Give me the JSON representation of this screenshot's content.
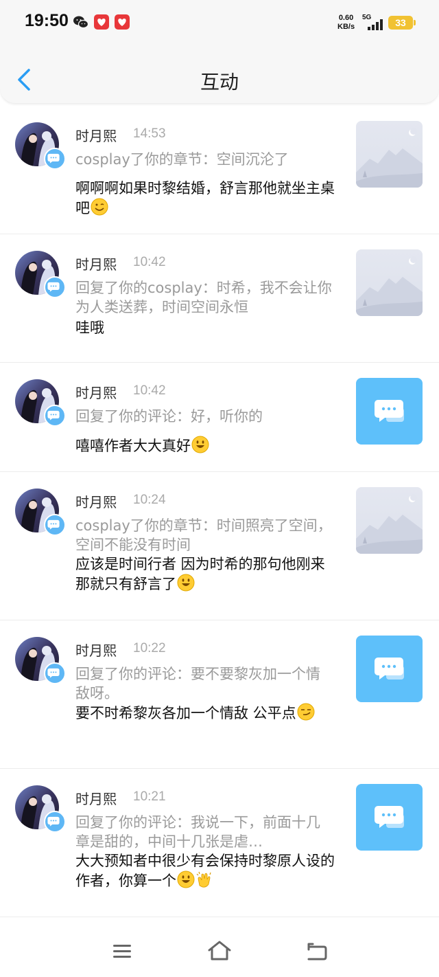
{
  "status_bar": {
    "time": "19:50",
    "net_speed_value": "0.60",
    "net_speed_unit": "KB/s",
    "net_type": "5G",
    "battery": "33",
    "icons": [
      "wechat-icon",
      "app-heart-icon",
      "app-heart-icon"
    ]
  },
  "header": {
    "title": "互动",
    "back_icon": "chevron-left-icon"
  },
  "colors": {
    "accent": "#5eb7f5",
    "message_thumb": "#5ec0fa",
    "battery": "#f1c232"
  },
  "items": [
    {
      "user": "时月熙",
      "time": "14:53",
      "quote": "cosplay了你的章节：空间沉沦了",
      "reply": "啊啊啊如果时黎结婚，舒言那他就坐主桌吧",
      "emoji": [
        "winking-face-icon"
      ],
      "thumb": "image-placeholder-icon"
    },
    {
      "user": "时月熙",
      "time": "10:42",
      "quote": "回复了你的cosplay：时希，我不会让你为人类送葬，时间空间永恒",
      "reply": "哇哦",
      "emoji": [],
      "thumb": "image-placeholder-icon"
    },
    {
      "user": "时月熙",
      "time": "10:42",
      "quote": "回复了你的评论：好，听你的",
      "reply": "嘻嘻作者大大真好",
      "emoji": [
        "smiling-face-icon"
      ],
      "thumb": "comment-bubble-icon"
    },
    {
      "user": "时月熙",
      "time": "10:24",
      "quote": "cosplay了你的章节：时间照亮了空间，空间不能没有时间",
      "reply": "应该是时间行者 因为时希的那句他刚来 那就只有舒言了",
      "emoji": [
        "smiling-face-icon"
      ],
      "thumb": "image-placeholder-icon"
    },
    {
      "user": "时月熙",
      "time": "10:22",
      "quote": "回复了你的评论：要不要黎灰加一个情敌呀。",
      "reply": "要不时希黎灰各加一个情敌 公平点",
      "emoji": [
        "smirking-face-icon"
      ],
      "thumb": "comment-bubble-icon"
    },
    {
      "user": "时月熙",
      "time": "10:21",
      "quote": "回复了你的评论：我说一下，前面十几章是甜的，中间十几张是虐…",
      "reply": "大大预知者中很少有会保持时黎原人设的作者，你算一个",
      "emoji": [
        "smiling-face-icon",
        "clapping-hands-icon"
      ],
      "thumb": "comment-bubble-icon"
    }
  ],
  "navbar": {
    "icons": [
      "menu-icon",
      "home-icon",
      "back-icon"
    ]
  }
}
